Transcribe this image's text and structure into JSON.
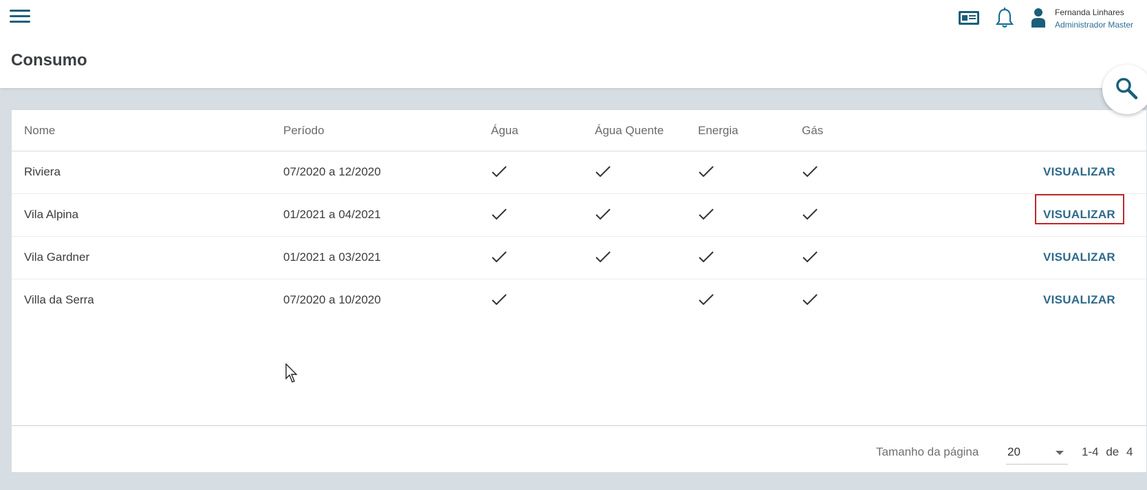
{
  "header": {
    "page_title": "Consumo",
    "user_name": "Fernanda Linhares",
    "user_role": "Administrador Master"
  },
  "table": {
    "columns": [
      "Nome",
      "Período",
      "Água",
      "Água Quente",
      "Energia",
      "Gás"
    ],
    "rows": [
      {
        "nome": "Riviera",
        "periodo": "07/2020 a 12/2020",
        "agua": true,
        "agua_quente": true,
        "energia": true,
        "gas": true,
        "action": "VISUALIZAR"
      },
      {
        "nome": "Vila Alpina",
        "periodo": "01/2021 a 04/2021",
        "agua": true,
        "agua_quente": true,
        "energia": true,
        "gas": true,
        "action": "VISUALIZAR"
      },
      {
        "nome": "Vila Gardner",
        "periodo": "01/2021 a 03/2021",
        "agua": true,
        "agua_quente": true,
        "energia": true,
        "gas": true,
        "action": "VISUALIZAR"
      },
      {
        "nome": "Villa da Serra",
        "periodo": "07/2020 a 10/2020",
        "agua": true,
        "agua_quente": false,
        "energia": true,
        "gas": true,
        "action": "VISUALIZAR"
      }
    ]
  },
  "pagination": {
    "page_size_label": "Tamanho da página",
    "page_size_value": "20",
    "range": "1-4",
    "of_label": "de",
    "total": "4"
  },
  "icons": {
    "menu": "hamburger-icon",
    "card": "id-card-icon",
    "bell": "bell-icon",
    "user": "user-icon",
    "search": "search-icon",
    "check": "check-icon"
  },
  "colors": {
    "accent": "#2d6a8a",
    "highlight": "#c0272d",
    "background": "#d6dde3"
  }
}
